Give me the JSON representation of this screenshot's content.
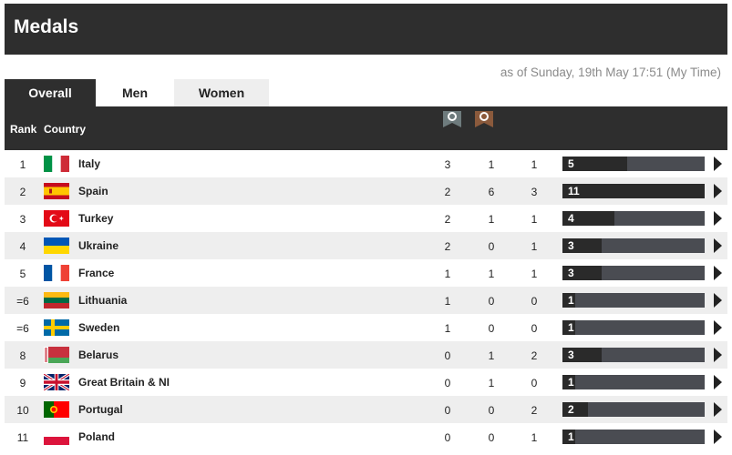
{
  "header": {
    "title": "Medals"
  },
  "timestamp": "as of Sunday, 19th May 17:51 (My Time)",
  "tabs": [
    {
      "label": "Overall",
      "active": true
    },
    {
      "label": "Men",
      "active": false
    },
    {
      "label": "Women",
      "active": false
    }
  ],
  "columns": {
    "rank": "Rank",
    "country": "Country",
    "gold": "",
    "silver": "silver-medal-icon",
    "bronze": "bronze-medal-icon"
  },
  "colors": {
    "dark": "#2e2e2e",
    "bar_bg": "#4a4c52",
    "bar_fill": "#2a2a2a",
    "alt_row": "#eeeeee",
    "silver": "#6e7b7d",
    "bronze": "#8b5a3c"
  },
  "rows": [
    {
      "rank": "1",
      "country": "Italy",
      "flag": "italy-flag",
      "gold": "3",
      "silver": "1",
      "bronze": "1",
      "total": "5"
    },
    {
      "rank": "2",
      "country": "Spain",
      "flag": "spain-flag",
      "gold": "2",
      "silver": "6",
      "bronze": "3",
      "total": "11"
    },
    {
      "rank": "3",
      "country": "Turkey",
      "flag": "turkey-flag",
      "gold": "2",
      "silver": "1",
      "bronze": "1",
      "total": "4"
    },
    {
      "rank": "4",
      "country": "Ukraine",
      "flag": "ukraine-flag",
      "gold": "2",
      "silver": "0",
      "bronze": "1",
      "total": "3"
    },
    {
      "rank": "5",
      "country": "France",
      "flag": "france-flag",
      "gold": "1",
      "silver": "1",
      "bronze": "1",
      "total": "3"
    },
    {
      "rank": "=6",
      "country": "Lithuania",
      "flag": "lithuania-flag",
      "gold": "1",
      "silver": "0",
      "bronze": "0",
      "total": "1"
    },
    {
      "rank": "=6",
      "country": "Sweden",
      "flag": "sweden-flag",
      "gold": "1",
      "silver": "0",
      "bronze": "0",
      "total": "1"
    },
    {
      "rank": "8",
      "country": "Belarus",
      "flag": "belarus-flag",
      "gold": "0",
      "silver": "1",
      "bronze": "2",
      "total": "3"
    },
    {
      "rank": "9",
      "country": "Great Britain & NI",
      "flag": "great-britain-flag",
      "gold": "0",
      "silver": "1",
      "bronze": "0",
      "total": "1"
    },
    {
      "rank": "10",
      "country": "Portugal",
      "flag": "portugal-flag",
      "gold": "0",
      "silver": "0",
      "bronze": "2",
      "total": "2"
    },
    {
      "rank": "11",
      "country": "Poland",
      "flag": "poland-flag",
      "gold": "0",
      "silver": "0",
      "bronze": "1",
      "total": "1"
    }
  ]
}
